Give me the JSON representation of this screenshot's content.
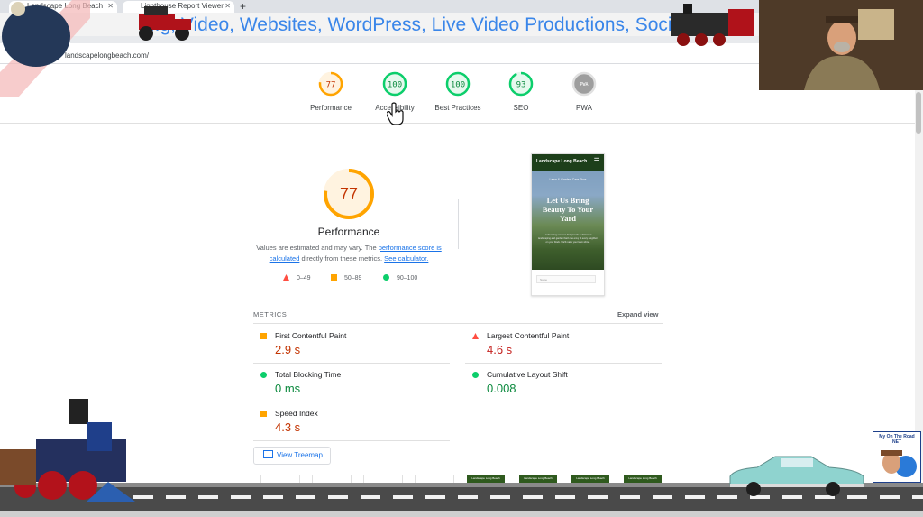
{
  "browser": {
    "tabs": [
      {
        "label": "Landscape Long Beach"
      },
      {
        "label": "Lighthouse Report Viewer"
      }
    ],
    "new_tab_symbol": "+",
    "url_partial": "landscapelongbeach.com/"
  },
  "overlay": {
    "banner_text": "...g, Video, Websites, WordPress, Live Video Productions, Social M",
    "badge_text": "My On The Road NET"
  },
  "gauges": [
    {
      "label": "Performance",
      "score": "77",
      "value": 0.77,
      "color": "#ffa400",
      "track": "#fff3e0",
      "text_color": "#c33300"
    },
    {
      "label": "Accessibility",
      "score": "100",
      "value": 1.0,
      "color": "#0cce6b",
      "track": "#e6f9ee",
      "text_color": "#0d8a3f"
    },
    {
      "label": "Best Practices",
      "score": "100",
      "value": 1.0,
      "color": "#0cce6b",
      "track": "#e6f9ee",
      "text_color": "#0d8a3f"
    },
    {
      "label": "SEO",
      "score": "93",
      "value": 0.93,
      "color": "#0cce6b",
      "track": "#e6f9ee",
      "text_color": "#0d8a3f"
    },
    {
      "label": "PWA",
      "score": "PWA",
      "value": 0,
      "color": "#9e9e9e",
      "track": "#e0e0e0",
      "text_color": "#ffffff"
    }
  ],
  "performance": {
    "score": "77",
    "value": 0.77,
    "title": "Performance",
    "desc_prefix": "Values are estimated and may vary. The ",
    "desc_link1": "performance score is calculated",
    "desc_middle": " directly from these metrics. ",
    "desc_link2": "See calculator.",
    "legend": [
      {
        "range": "0–49",
        "shape": "triangle",
        "color": "#ff4e42"
      },
      {
        "range": "50–89",
        "shape": "square",
        "color": "#ffa400"
      },
      {
        "range": "90–100",
        "shape": "circle",
        "color": "#0cce6b"
      }
    ]
  },
  "preview": {
    "brand": "Landscape Long Beach",
    "menu_icon": "hamburger-icon",
    "kicker": "Lawn & Garden Care Pros",
    "headline": "Let Us Bring Beauty To Your Yard",
    "body": "Landscaping services that provide a distinctive landscaping and garden that's the envy of every neighbor on your block. We'll make your lawn shine.",
    "form_placeholder": "Name"
  },
  "metrics": {
    "section_label": "METRICS",
    "expand_label": "Expand view",
    "items": [
      {
        "label": "First Contentful Paint",
        "value": "2.9 s",
        "status": "average"
      },
      {
        "label": "Largest Contentful Paint",
        "value": "4.6 s",
        "status": "fail"
      },
      {
        "label": "Total Blocking Time",
        "value": "0 ms",
        "status": "pass"
      },
      {
        "label": "Cumulative Layout Shift",
        "value": "0.008",
        "status": "pass"
      },
      {
        "label": "Speed Index",
        "value": "4.3 s",
        "status": "average"
      }
    ],
    "treemap_label": "View Treemap"
  },
  "filmstrip_caption": "Landscape Long Beach"
}
